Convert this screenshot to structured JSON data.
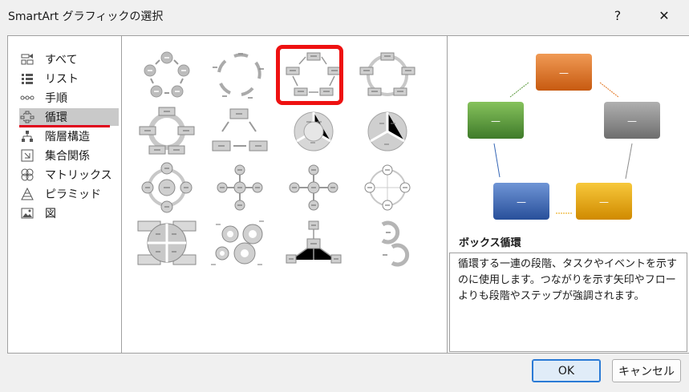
{
  "window": {
    "title": "SmartArt グラフィックの選択",
    "help_label": "?",
    "close_label": "✕"
  },
  "categories": [
    {
      "label": "すべて",
      "icon": "all-icon",
      "selected": false
    },
    {
      "label": "リスト",
      "icon": "list-icon",
      "selected": false
    },
    {
      "label": "手順",
      "icon": "process-icon",
      "selected": false
    },
    {
      "label": "循環",
      "icon": "cycle-icon",
      "selected": true
    },
    {
      "label": "階層構造",
      "icon": "hierarchy-icon",
      "selected": false
    },
    {
      "label": "集合関係",
      "icon": "relationship-icon",
      "selected": false
    },
    {
      "label": "マトリックス",
      "icon": "matrix-icon",
      "selected": false
    },
    {
      "label": "ピラミッド",
      "icon": "pyramid-icon",
      "selected": false
    },
    {
      "label": "図",
      "icon": "picture-icon",
      "selected": false
    }
  ],
  "gallery": {
    "selected": "box-cycle",
    "items": [
      "basic-cycle",
      "text-cycle",
      "box-cycle",
      "continuous-cycle",
      "block-cycle",
      "segmented-cycle",
      "nondirectional-cycle",
      "multidirectional-cycle",
      "radial-cycle",
      "diverging-radial",
      "radial-cluster",
      "cycle-matrix",
      "gear",
      "hub-radial",
      "basic-radial",
      "circular-arrows"
    ]
  },
  "preview": {
    "title": "ボックス循環",
    "description": "循環する一連の段階、タスクやイベントを示すのに使用します。つながりを示す矢印やフローよりも段階やステップが強調されます。",
    "box_text": "—",
    "colors": {
      "orange": "#e2731e",
      "gray": "#8c8c8c",
      "gold": "#e9a300",
      "blue": "#3566b5",
      "green": "#5b9a3c"
    }
  },
  "buttons": {
    "ok": "OK",
    "cancel": "キャンセル"
  }
}
